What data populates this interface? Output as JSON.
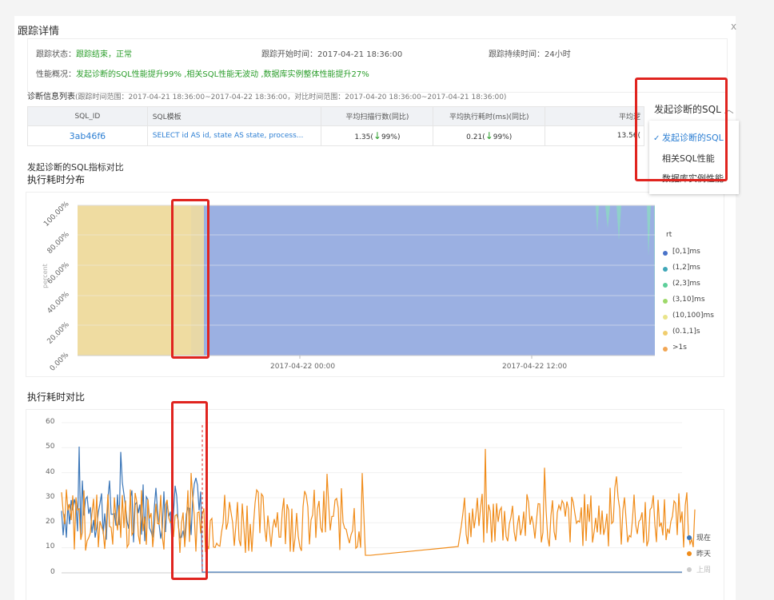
{
  "panel": {
    "title": "跟踪详情",
    "close": "x"
  },
  "status": {
    "state_label": "跟踪状态：",
    "state_value": "跟踪结束，正常",
    "start_label": "跟踪开始时间：",
    "start_value": "2017-04-21 18:36:00",
    "duration_label": "跟踪持续时间：",
    "duration_value": "24小时",
    "perf_label": "性能概况：",
    "perf_value": "发起诊断的SQL性能提升99% ,相关SQL性能无波动 ,数据库实例整体性能提升27%"
  },
  "diag_list": {
    "title": "诊断信息列表",
    "range": "(跟踪时间范围：2017-04-21 18:36:00~2017-04-22 18:36:00，对比时间范围：2017-04-20 18:36:00~2017-04-21 18:36:00)",
    "columns": [
      "SQL_ID",
      "SQL模板",
      "平均扫描行数(同比)",
      "平均执行耗时(ms)(同比)",
      "平均逻"
    ],
    "row": {
      "sql_id": "3ab46f6",
      "template": "SELECT id AS id, state AS state, process...",
      "scan": "1.35(",
      "scan_pct": "99%)",
      "exec": "0.21(",
      "exec_pct": "99%)",
      "logic": "13.56("
    }
  },
  "dropdown": {
    "selected": "发起诊断的SQL",
    "options": [
      "发起诊断的SQL",
      "相关SQL性能",
      "数据库实例性能"
    ]
  },
  "section": {
    "compare": "发起诊断的SQL指标对比",
    "dist": "执行耗时分布",
    "cmp": "执行耗时对比"
  },
  "colors": {
    "accent": "#2d7fd3",
    "green": "#2a9d2a",
    "red": "#e0241f",
    "blue_area": "#9bb0e2",
    "tan_area": "#efdca1",
    "orange": "#f08c1a",
    "blue_line": "#3b76b8"
  },
  "chart_data": [
    {
      "type": "area",
      "ylabel": "percent",
      "y_ticks": [
        "100.00%",
        "80.00%",
        "60.00%",
        "40.00%",
        "20.00%",
        "0.00%"
      ],
      "x_ticks": [
        "2017-04-22 00:00",
        "2017-04-22 12:00"
      ],
      "legend_title": "rt",
      "legend": [
        {
          "name": "[0,1]ms",
          "color": "#4a73c9"
        },
        {
          "name": "(1,2]ms",
          "color": "#3fa7b8"
        },
        {
          "name": "(2,3]ms",
          "color": "#5ecf9a"
        },
        {
          "name": "(3,10]ms",
          "color": "#9ed96a"
        },
        {
          "name": "(10,100]ms",
          "color": "#e9e48a"
        },
        {
          "name": "(0.1,1]s",
          "color": "#f0cd6e"
        },
        {
          "name": ">1s",
          "color": "#f2a654"
        }
      ]
    },
    {
      "type": "line",
      "y_ticks": [
        "60",
        "50",
        "40",
        "30",
        "20",
        "10",
        "0"
      ],
      "ylim": [
        0,
        60
      ],
      "legend": [
        {
          "name": "现在",
          "color": "#3b76b8"
        },
        {
          "name": "昨天",
          "color": "#f08c1a"
        },
        {
          "name": "上周",
          "color": "#cccccc"
        }
      ]
    }
  ]
}
